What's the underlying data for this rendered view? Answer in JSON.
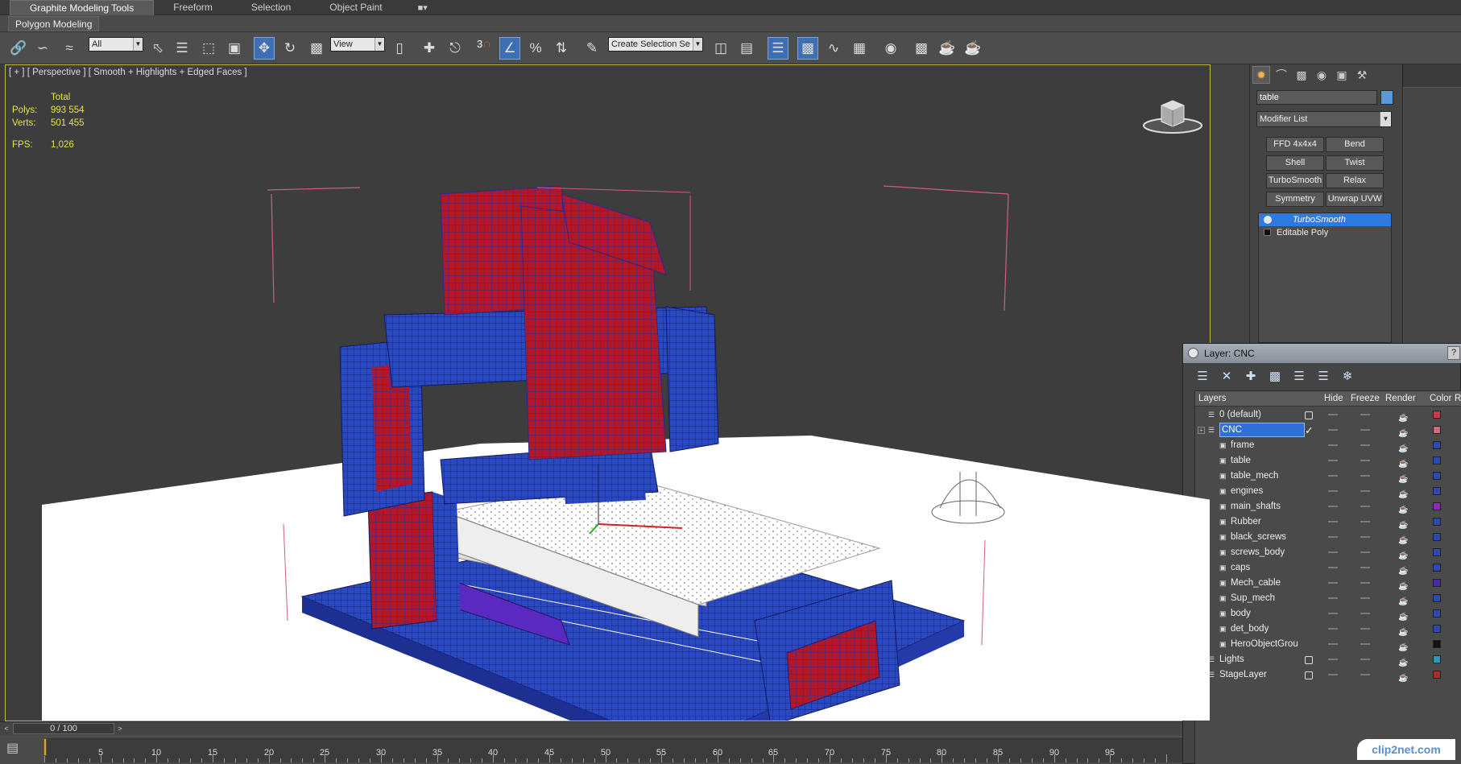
{
  "ribbon": {
    "tabs": [
      "Graphite Modeling Tools",
      "Freeform",
      "Selection",
      "Object Paint"
    ],
    "dropdown_icon": "chevron-down-icon",
    "sub_label": "Polygon Modeling"
  },
  "toolbar": {
    "selection_filter": "All",
    "ref_coord": "View",
    "named_selection": "Create Selection Se",
    "snap_value": "3",
    "icons": [
      "link-icon",
      "unlink-icon",
      "bind-spacewarp-icon",
      "select-object-icon",
      "select-by-name-icon",
      "rect-region-icon",
      "window-crossing-icon",
      "move-icon",
      "rotate-icon",
      "scale-icon",
      "pivot-icon",
      "manipulate-icon",
      "keyboard-shortcut-icon",
      "snap-icon",
      "angle-snap-icon",
      "percent-snap-icon",
      "spinner-snap-icon",
      "edit-named-sel-icon",
      "mirror-icon",
      "align-icon",
      "layer-manager-icon",
      "graphite-icon",
      "curve-editor-icon",
      "schematic-icon",
      "material-editor-icon",
      "render-setup-icon",
      "rendered-frame-icon",
      "render-icon"
    ]
  },
  "viewport": {
    "label": "[ + ] [ Perspective ] [ Smooth + Highlights + Edged Faces ]",
    "stats": {
      "total_label": "Total",
      "polys_label": "Polys:",
      "polys": "993 554",
      "verts_label": "Verts:",
      "verts": "501 455",
      "fps_label": "FPS:",
      "fps": "1,026"
    },
    "viewcube_icon": "viewcube-icon",
    "colors": {
      "background": "#3d3d3d",
      "floor": "#ffffff",
      "wire": "#2846b8",
      "solid": "#b51a2a",
      "border": "#c9b74a",
      "stats": "#e6e34c"
    }
  },
  "timeline": {
    "frame_label": "0 / 100",
    "prev_icon": "chevron-left-icon",
    "next_icon": "chevron-right-icon",
    "ticks": [
      "5",
      "10",
      "15",
      "20",
      "25",
      "30",
      "35",
      "40",
      "45",
      "50",
      "55",
      "60",
      "65",
      "70",
      "75",
      "80",
      "85",
      "90",
      "95"
    ]
  },
  "command_panel": {
    "tab_icons": [
      "create-icon",
      "modify-icon",
      "hierarchy-icon",
      "motion-icon",
      "display-icon",
      "utilities-icon"
    ],
    "object_name": "table",
    "object_color": "#5b98dd",
    "modifier_list": "Modifier List",
    "modifier_buttons": [
      "FFD 4x4x4",
      "Bend",
      "Shell",
      "Twist",
      "TurboSmooth",
      "Relax",
      "Symmetry",
      "Unwrap UVW"
    ],
    "stack": [
      "TurboSmooth",
      "Editable Poly"
    ]
  },
  "layer_explorer": {
    "title": "Layer: CNC",
    "help": "?",
    "tool_icons": [
      "new-layer-icon",
      "delete-icon",
      "add-icon",
      "select-objects-icon",
      "select-layer-icon",
      "hide-all-icon",
      "freeze-all-icon"
    ],
    "columns": [
      "Layers",
      "Hide",
      "Freeze",
      "Render",
      "Color",
      "Ra"
    ],
    "rows": [
      {
        "name": "0 (default)",
        "level": 0,
        "expandable": false,
        "active_box": true,
        "color": "#c83a4a"
      },
      {
        "name": "CNC",
        "level": 0,
        "expandable": true,
        "selected": true,
        "current": true,
        "color": "#d06a80"
      },
      {
        "name": "frame",
        "level": 1,
        "color": "#2a4ab0"
      },
      {
        "name": "table",
        "level": 1,
        "color": "#2a4ab0"
      },
      {
        "name": "table_mech",
        "level": 1,
        "color": "#2a4ab0"
      },
      {
        "name": "engines",
        "level": 1,
        "color": "#2a4ab0"
      },
      {
        "name": "main_shafts",
        "level": 1,
        "color": "#8a2ab8"
      },
      {
        "name": "Rubber",
        "level": 1,
        "color": "#2a4ab0"
      },
      {
        "name": "black_screws",
        "level": 1,
        "color": "#2a4ab0"
      },
      {
        "name": "screws_body",
        "level": 1,
        "color": "#2a4ab0"
      },
      {
        "name": "caps",
        "level": 1,
        "color": "#2a4ab0"
      },
      {
        "name": "Mech_cable",
        "level": 1,
        "color": "#4a2aa8"
      },
      {
        "name": "Sup_mech",
        "level": 1,
        "color": "#2a4ab0"
      },
      {
        "name": "body",
        "level": 1,
        "color": "#2a4ab0"
      },
      {
        "name": "det_body",
        "level": 1,
        "color": "#2a4ab0"
      },
      {
        "name": "HeroObjectGrou",
        "level": 1,
        "color": "#111111"
      },
      {
        "name": "Lights",
        "level": 0,
        "expandable": true,
        "active_box": true,
        "color": "#2a9ab8"
      },
      {
        "name": "StageLayer",
        "level": 0,
        "expandable": true,
        "active_box": true,
        "color": "#a82a2a"
      }
    ]
  },
  "watermark": "clip2net.com"
}
